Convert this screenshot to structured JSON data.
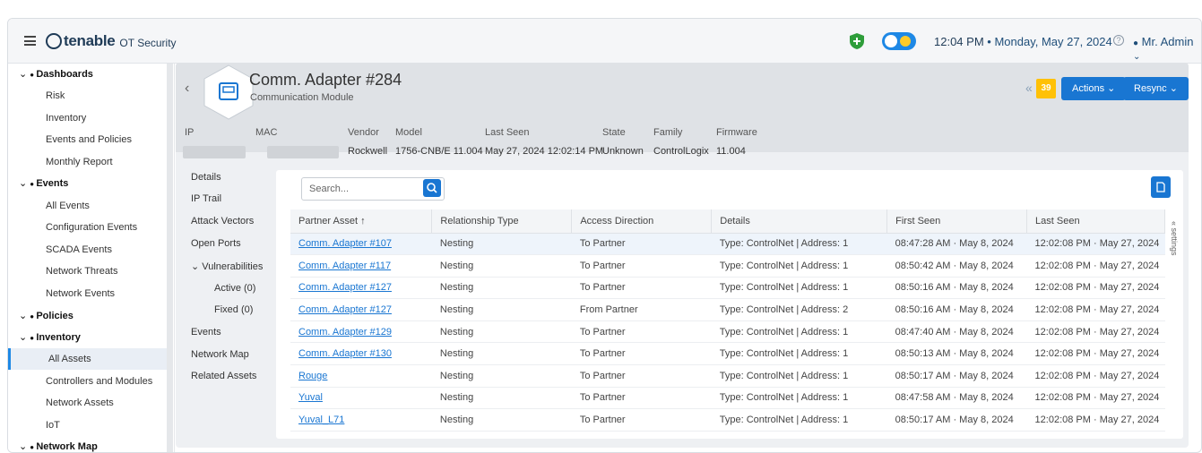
{
  "topbar": {
    "brand": "tenable",
    "product": "OT Security",
    "time": "12:04 PM",
    "separator": "•",
    "date": "Monday, May 27, 2024",
    "user": "Mr. Admin"
  },
  "nav": {
    "items": [
      {
        "label": "Dashboards",
        "type": "head"
      },
      {
        "label": "Risk",
        "type": "sub"
      },
      {
        "label": "Inventory",
        "type": "sub"
      },
      {
        "label": "Events and Policies",
        "type": "sub"
      },
      {
        "label": "Monthly Report",
        "type": "sub"
      },
      {
        "label": "Events",
        "type": "head"
      },
      {
        "label": "All Events",
        "type": "sub"
      },
      {
        "label": "Configuration Events",
        "type": "sub"
      },
      {
        "label": "SCADA Events",
        "type": "sub"
      },
      {
        "label": "Network Threats",
        "type": "sub"
      },
      {
        "label": "Network Events",
        "type": "sub"
      },
      {
        "label": "Policies",
        "type": "head"
      },
      {
        "label": "Inventory",
        "type": "head"
      },
      {
        "label": "All Assets",
        "type": "sub",
        "active": true
      },
      {
        "label": "Controllers and Modules",
        "type": "sub"
      },
      {
        "label": "Network Assets",
        "type": "sub"
      },
      {
        "label": "IoT",
        "type": "sub"
      },
      {
        "label": "Network Map",
        "type": "head"
      }
    ]
  },
  "asset": {
    "title": "Comm. Adapter #284",
    "subtitle": "Communication Module",
    "badge_count": "39",
    "actions_label": "Actions",
    "resync_label": "Resync",
    "meta_headers": [
      "IP",
      "MAC",
      "Vendor",
      "Model",
      "Last Seen",
      "State",
      "Family",
      "Firmware"
    ],
    "meta_values": {
      "vendor": "Rockwell",
      "model": "1756-CNB/E 11.004",
      "last_seen": "May 27, 2024 12:02:14 PM",
      "state": "Unknown",
      "family": "ControlLogix",
      "firmware": "11.004"
    }
  },
  "subnav": {
    "details": "Details",
    "ip_trail": "IP Trail",
    "attack_vectors": "Attack Vectors",
    "open_ports": "Open Ports",
    "vulnerabilities": "Vulnerabilities",
    "active": "Active (0)",
    "fixed": "Fixed (0)",
    "events": "Events",
    "network_map": "Network Map",
    "related_assets": "Related Assets"
  },
  "search": {
    "placeholder": "Search..."
  },
  "settings_label": "settings",
  "table": {
    "headers": [
      "Partner Asset ↑",
      "Relationship Type",
      "Access Direction",
      "Details",
      "First Seen",
      "Last Seen"
    ],
    "rows": [
      [
        "Comm. Adapter #107",
        "Nesting",
        "To Partner",
        "Type: ControlNet | Address: 1",
        "08:47:28 AM · May 8, 2024",
        "12:02:08 PM · May 27, 2024"
      ],
      [
        "Comm. Adapter #117",
        "Nesting",
        "To Partner",
        "Type: ControlNet | Address: 1",
        "08:50:42 AM · May 8, 2024",
        "12:02:08 PM · May 27, 2024"
      ],
      [
        "Comm. Adapter #127",
        "Nesting",
        "To Partner",
        "Type: ControlNet | Address: 1",
        "08:50:16 AM · May 8, 2024",
        "12:02:08 PM · May 27, 2024"
      ],
      [
        "Comm. Adapter #127",
        "Nesting",
        "From Partner",
        "Type: ControlNet | Address: 2",
        "08:50:16 AM · May 8, 2024",
        "12:02:08 PM · May 27, 2024"
      ],
      [
        "Comm. Adapter #129",
        "Nesting",
        "To Partner",
        "Type: ControlNet | Address: 1",
        "08:47:40 AM · May 8, 2024",
        "12:02:08 PM · May 27, 2024"
      ],
      [
        "Comm. Adapter #130",
        "Nesting",
        "To Partner",
        "Type: ControlNet | Address: 1",
        "08:50:13 AM · May 8, 2024",
        "12:02:08 PM · May 27, 2024"
      ],
      [
        "Rouge",
        "Nesting",
        "To Partner",
        "Type: ControlNet | Address: 1",
        "08:50:17 AM · May 8, 2024",
        "12:02:08 PM · May 27, 2024"
      ],
      [
        "Yuval",
        "Nesting",
        "To Partner",
        "Type: ControlNet | Address: 1",
        "08:47:58 AM · May 8, 2024",
        "12:02:08 PM · May 27, 2024"
      ],
      [
        "Yuval_L71",
        "Nesting",
        "To Partner",
        "Type: ControlNet | Address: 1",
        "08:50:17 AM · May 8, 2024",
        "12:02:08 PM · May 27, 2024"
      ]
    ]
  }
}
